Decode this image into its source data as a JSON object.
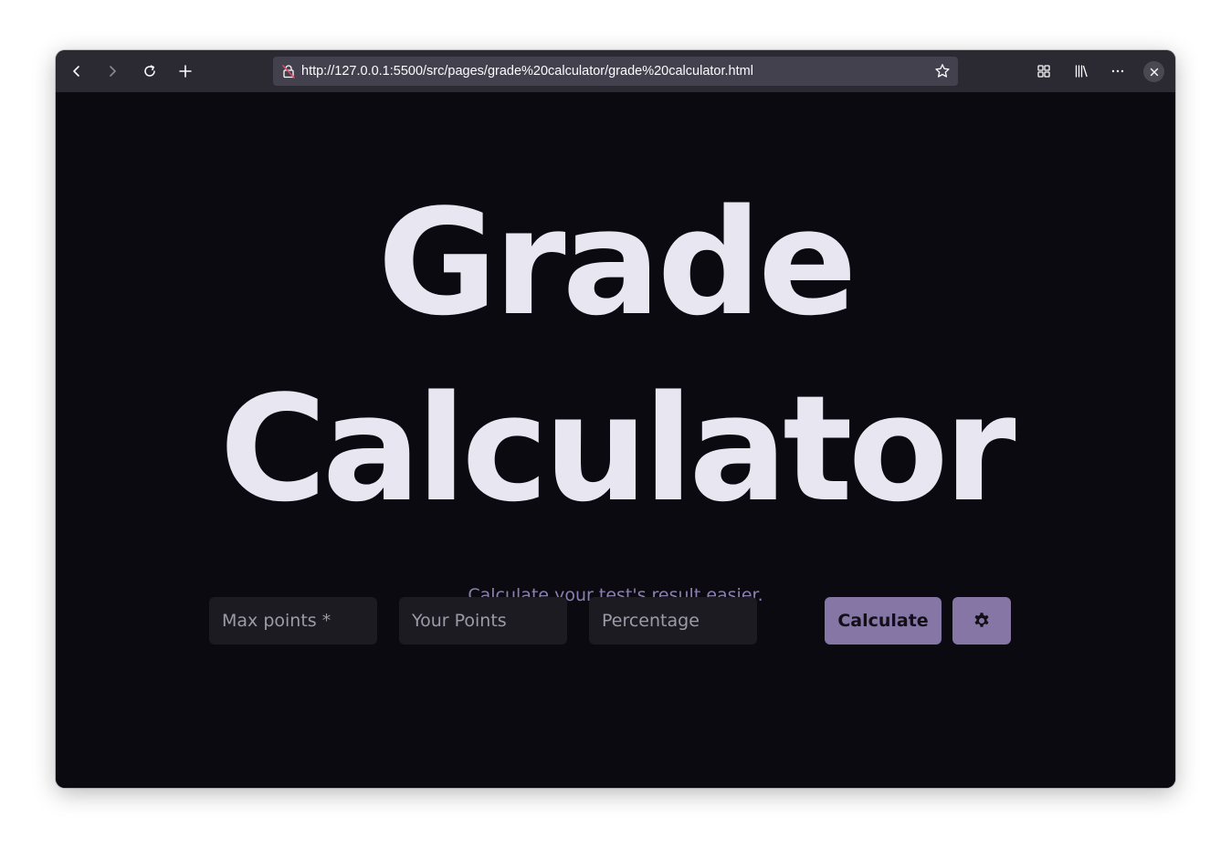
{
  "browser": {
    "url": "http://127.0.0.1:5500/src/pages/grade%20calculator/grade%20calculator.html",
    "icons": {
      "back": "arrow-left-icon",
      "forward": "arrow-right-icon",
      "reload": "reload-icon",
      "new_tab": "plus-icon",
      "lock": "insecure-lock-icon",
      "bookmark": "star-icon",
      "extensions": "grid-icon",
      "library": "library-icon",
      "menu": "ellipsis-icon",
      "close": "close-icon"
    }
  },
  "page": {
    "title_line1": "Grade",
    "title_line2": "Calculator",
    "subtitle": "Calculate your test's result easier.",
    "inputs": {
      "max_points": {
        "placeholder": "Max points *",
        "value": ""
      },
      "your_points": {
        "placeholder": "Your Points",
        "value": ""
      },
      "percentage": {
        "placeholder": "Percentage",
        "value": ""
      }
    },
    "calculate_label": "Calculate",
    "settings_icon": "gear-icon"
  },
  "colors": {
    "background": "#0c0a11",
    "title": "#e8e6f0",
    "subtitle": "#8b7fb0",
    "accent": "#8676a6",
    "field_bg": "#1c1b22",
    "toolbar": "#2b2a33"
  }
}
